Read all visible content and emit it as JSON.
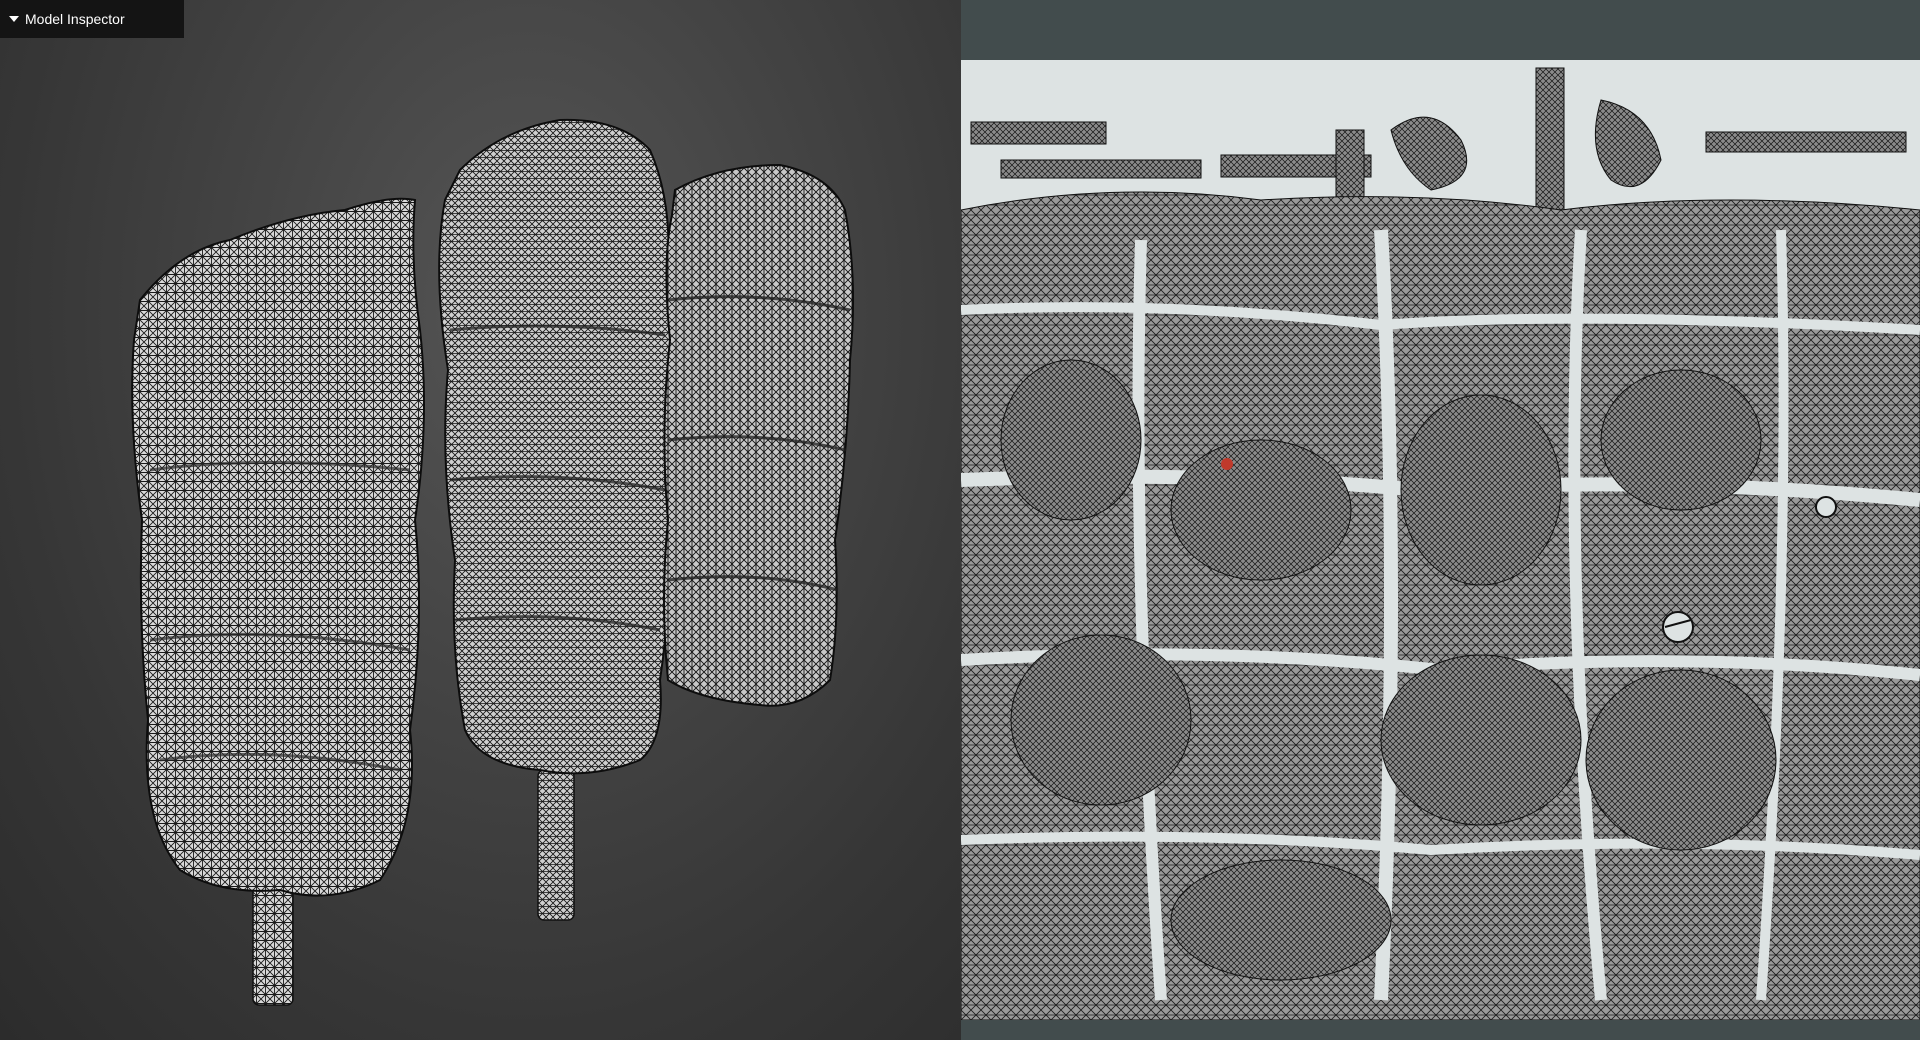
{
  "panel": {
    "title": "Model Inspector",
    "collapse_icon": "triangle-down-icon"
  },
  "viewport_3d": {
    "background_color": "#3a3a3a",
    "mesh_color": "#111111",
    "highlight_color": "#ffffff",
    "objects": [
      "mesh-left",
      "mesh-center",
      "mesh-right"
    ]
  },
  "uv_editor": {
    "frame_color": "#424c4d",
    "canvas_color": "#dde3e3",
    "wire_color": "#222222",
    "selected_vertex_color": "#c0392b"
  }
}
